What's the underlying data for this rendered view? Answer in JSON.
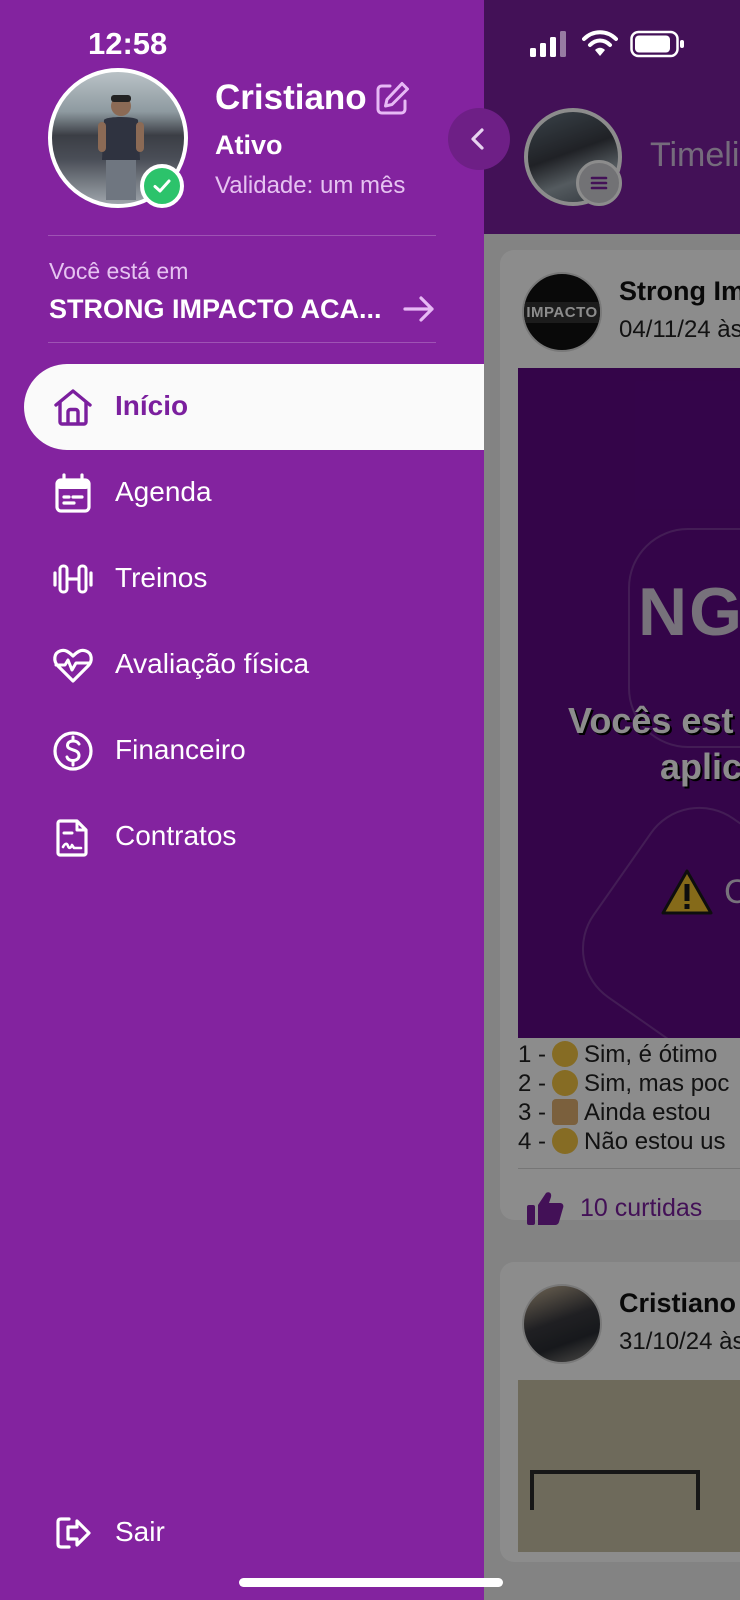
{
  "status_bar": {
    "time": "12:58"
  },
  "drawer": {
    "user": {
      "name": "Cristiano",
      "status": "Ativo",
      "validity": "Validade: um mês"
    },
    "location": {
      "caption": "Você está em",
      "name": "STRONG IMPACTO ACA..."
    },
    "menu": [
      {
        "label": "Início",
        "icon": "home-icon",
        "active": true
      },
      {
        "label": "Agenda",
        "icon": "calendar-icon",
        "active": false
      },
      {
        "label": "Treinos",
        "icon": "dumbbell-icon",
        "active": false
      },
      {
        "label": "Avaliação física",
        "icon": "heart-pulse-icon",
        "active": false
      },
      {
        "label": "Financeiro",
        "icon": "dollar-icon",
        "active": false
      },
      {
        "label": "Contratos",
        "icon": "document-icon",
        "active": false
      }
    ],
    "logout_label": "Sair"
  },
  "background": {
    "header_title": "Timeli",
    "posts": [
      {
        "author": "Strong Im",
        "date": "04/11/24 às",
        "logo_text": "IMPACTO",
        "image_text": {
          "brand": "NG",
          "headline_line1": "Vocês est",
          "headline_line2": "aplic",
          "warning_text": "C"
        },
        "poll": [
          {
            "prefix": "1 -",
            "text": "Sim, é ótimo"
          },
          {
            "prefix": "2 -",
            "text": "Sim, mas poc"
          },
          {
            "prefix": "3 -",
            "text": "Ainda estou"
          },
          {
            "prefix": "4 -",
            "text": "Não estou us"
          }
        ],
        "likes": "10 curtidas"
      },
      {
        "author": "Cristiano",
        "date": "31/10/24 às"
      }
    ]
  },
  "colors": {
    "drawer_purple": "#83239f",
    "accent_purple": "#7b1f9e",
    "online_green": "#2cc36b",
    "muted_lilac": "#e6c3f1"
  }
}
